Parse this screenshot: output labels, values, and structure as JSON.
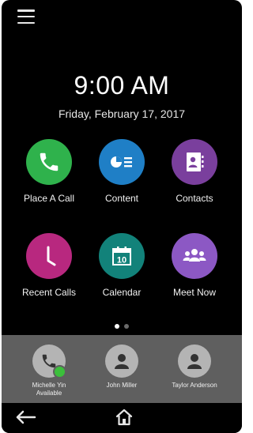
{
  "header": {
    "menu_icon": "hamburger-menu-icon"
  },
  "clock": {
    "time": "9:00 AM",
    "date": "Friday, February 17, 2017"
  },
  "apps": [
    {
      "label": "Place A Call",
      "icon": "phone-icon",
      "color": "#2fb24c"
    },
    {
      "label": "Content",
      "icon": "content-icon",
      "color": "#1f7fc6"
    },
    {
      "label": "Contacts",
      "icon": "contacts-icon",
      "color": "#7a3f9d"
    },
    {
      "label": "Recent Calls",
      "icon": "clock-icon",
      "color": "#b8287f"
    },
    {
      "label": "Calendar",
      "icon": "calendar-icon",
      "color": "#12827a"
    },
    {
      "label": "Meet Now",
      "icon": "group-icon",
      "color": "#8c58c4"
    }
  ],
  "calendar_icon_day": "10",
  "pager": {
    "pages": 2,
    "current": 1
  },
  "favorites": [
    {
      "name": "Michelle Yin",
      "status": "Available",
      "icon": "phone-icon"
    },
    {
      "name": "John Miller",
      "icon": "person-icon"
    },
    {
      "name": "Taylor Anderson",
      "icon": "person-icon"
    }
  ],
  "colors": {
    "background": "#000000",
    "favorites_bar": "#5f5f5f",
    "avatar": "#b4b4b4",
    "presence_available": "#3bbf3b"
  },
  "navbar": {
    "back_icon": "back-arrow-icon",
    "home_icon": "home-icon"
  }
}
